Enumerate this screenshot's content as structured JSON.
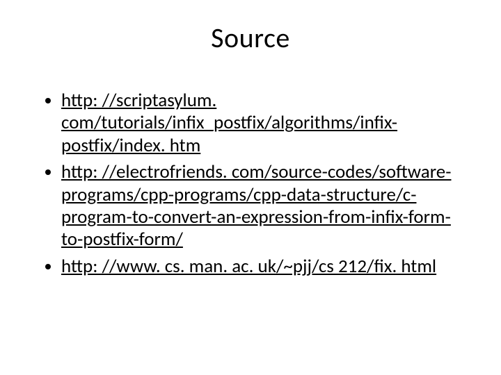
{
  "title": "Source",
  "links": [
    "http: //scriptasylum. com/tutorials/infix_postfix/algorithms/infix-postfix/index. htm",
    "http: //electrofriends. com/source-codes/software-programs/cpp-programs/cpp-data-structure/c-program-to-convert-an-expression-from-infix-form-to-postfix-form/",
    "http: //www. cs. man. ac. uk/~pjj/cs 212/fix. html"
  ]
}
